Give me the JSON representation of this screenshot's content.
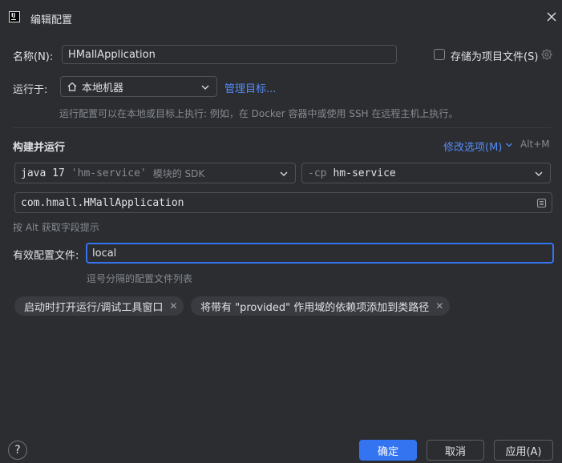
{
  "dialog": {
    "title": "编辑配置"
  },
  "name_row": {
    "label": "名称(N):",
    "value": "HMallApplication",
    "store_label": "存储为项目文件(S)"
  },
  "run_on": {
    "label": "运行于:",
    "target": "本地机器",
    "manage_link": "管理目标...",
    "hint": "运行配置可以在本地或目标上执行: 例如，在 Docker 容器中或使用 SSH 在远程主机上执行。"
  },
  "build": {
    "header": "构建并运行",
    "modify_options": "修改选项(M)",
    "shortcut": "Alt+M",
    "jdk_main": "java 17",
    "jdk_module": "'hm-service'",
    "jdk_suffix": "模块的 SDK",
    "cp_flag": "-cp",
    "cp_value": "hm-service",
    "main_class": "com.hmall.HMallApplication",
    "alt_hint": "按 Alt 获取字段提示"
  },
  "profiles": {
    "label": "有效配置文件:",
    "value": "local",
    "hint": "逗号分隔的配置文件列表"
  },
  "chips": [
    {
      "label": "启动时打开运行/调试工具窗口"
    },
    {
      "label": "将带有 \"provided\" 作用域的依赖项添加到类路径"
    }
  ],
  "footer": {
    "help": "?",
    "ok": "确定",
    "cancel": "取消",
    "apply": "应用(A)"
  },
  "colors": {
    "accent": "#3574f0",
    "link": "#548af7",
    "background": "#2b2d30"
  }
}
